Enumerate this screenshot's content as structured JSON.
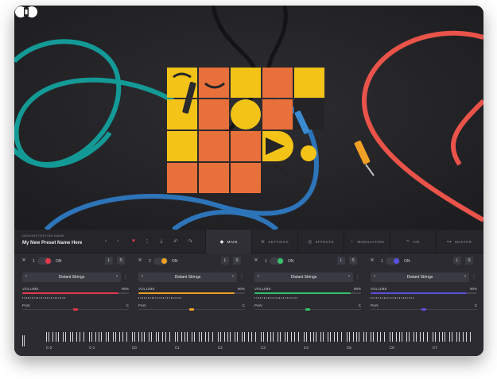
{
  "brand": {
    "logo_icon": "brand-logo-icon"
  },
  "hero": {
    "artwork_icon": "album-artwork-icon",
    "colors": {
      "yellow": "#f3c318",
      "orange": "#e8703a",
      "teal": "#149a96",
      "blue": "#2d74b8",
      "red": "#e9534a",
      "background": "#242427"
    }
  },
  "preset": {
    "caption": "DEMONSTRATION NAME",
    "name": "My New Preset Name Here",
    "prev_label": "‹",
    "next_label": "›",
    "favorite_icon": "heart-icon",
    "more_icon": "more-icon",
    "download_icon": "download-icon",
    "undo_icon": "undo-icon",
    "redo_icon": "redo-icon"
  },
  "tabs": [
    {
      "label": "MAIN",
      "icon": "main-icon",
      "active": true
    },
    {
      "label": "SETTINGS",
      "icon": "settings-icon",
      "active": false
    },
    {
      "label": "EFFECTS",
      "icon": "effects-icon",
      "active": false
    },
    {
      "label": "MODULATION",
      "icon": "modulation-icon",
      "active": false
    },
    {
      "label": "AIR",
      "icon": "air-icon",
      "active": false
    },
    {
      "label": "MASTER",
      "icon": "master-icon",
      "active": false
    }
  ],
  "channels": [
    {
      "number": "1",
      "on_label": "ON",
      "color": "#e5394b",
      "l": "L",
      "s": "S",
      "instrument": "Distant Strings",
      "volume_label": "VOLUME",
      "volume_value": "90%",
      "volume_fraction": 0.9,
      "pan_label": "PAN",
      "pan_value": "C"
    },
    {
      "number": "2",
      "on_label": "ON",
      "color": "#f0a024",
      "l": "L",
      "s": "S",
      "instrument": "Distant Strings",
      "volume_label": "VOLUME",
      "volume_value": "90%",
      "volume_fraction": 0.9,
      "pan_label": "PAN",
      "pan_value": "C"
    },
    {
      "number": "1",
      "on_label": "ON",
      "color": "#35c26a",
      "l": "L",
      "s": "S",
      "instrument": "Distant Strings",
      "volume_label": "VOLUME",
      "volume_value": "90%",
      "volume_fraction": 0.9,
      "pan_label": "PAN",
      "pan_value": "C"
    },
    {
      "number": "1",
      "on_label": "ON",
      "color": "#5a4fe0",
      "l": "L",
      "s": "S",
      "instrument": "Distant Strings",
      "volume_label": "VOLUME",
      "volume_value": "90%",
      "volume_fraction": 0.9,
      "pan_label": "PAN",
      "pan_value": "C"
    }
  ],
  "keyboard": {
    "octaves": [
      "C-2",
      "C-1",
      "C0",
      "C1",
      "C2",
      "C3",
      "C4",
      "C5",
      "C6",
      "C7"
    ]
  }
}
